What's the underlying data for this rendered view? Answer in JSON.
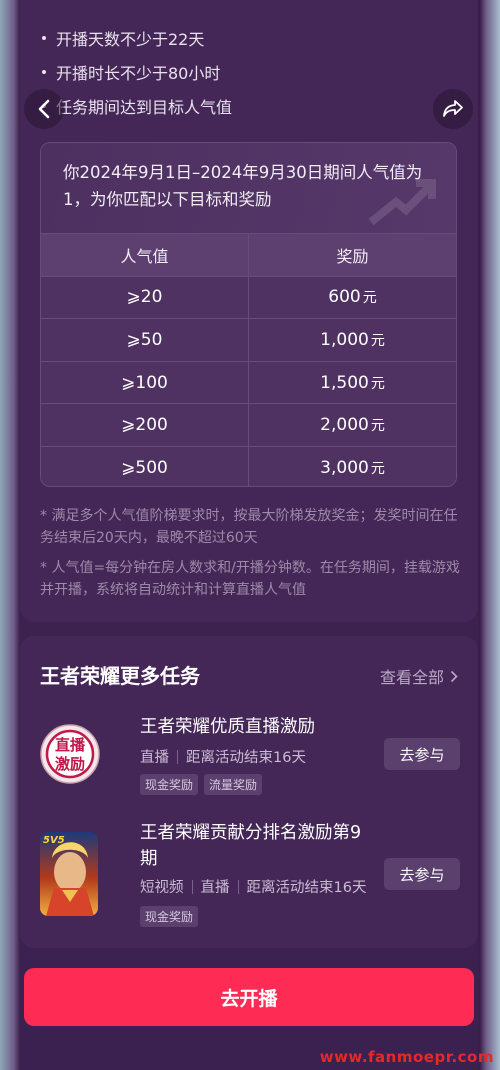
{
  "requirements": [
    "开播天数不少于22天",
    "开播时长不少于80小时",
    "任务期间达到目标人气值"
  ],
  "icons": {
    "back": "chevron-left-icon",
    "share": "share-icon"
  },
  "reward": {
    "description": "你2024年9月1日–2024年9月30日期间人气值为1，为你匹配以下目标和奖励",
    "header_popularity": "人气值",
    "header_reward": "奖励",
    "unit": "元",
    "rows": [
      {
        "target": "⩾20",
        "amount": "600"
      },
      {
        "target": "⩾50",
        "amount": "1,000"
      },
      {
        "target": "⩾100",
        "amount": "1,500"
      },
      {
        "target": "⩾200",
        "amount": "2,000"
      },
      {
        "target": "⩾500",
        "amount": "3,000"
      }
    ]
  },
  "notes": [
    "* 满足多个人气值阶梯要求时，按最大阶梯发放奖金；发奖时间在任务结束后20天内，最晚不超过60天",
    "* 人气值=每分钟在房人数求和/开播分钟数。在任务期间，挂载游戏并开播，系统将自动统计和计算直播人气值"
  ],
  "more": {
    "title": "王者荣耀更多任务",
    "see_all": "查看全部",
    "tasks": [
      {
        "name": "王者荣耀优质直播激励",
        "icon_text_1": "直播",
        "icon_text_2": "激励",
        "meta": [
          "直播",
          "距离活动结束16天"
        ],
        "tags": [
          "现金奖励",
          "流量奖励"
        ],
        "button": "去参与"
      },
      {
        "name": "王者荣耀贡献分排名激励第9期",
        "icon_badge": "5V5",
        "meta": [
          "短视频",
          "直播",
          "距离活动结束16天"
        ],
        "tags": [
          "现金奖励"
        ],
        "button": "去参与"
      }
    ]
  },
  "cta": "去开播",
  "watermark": "www.fanmoepr.com",
  "colors": {
    "accent": "#fe2c55",
    "panel": "#442757"
  }
}
